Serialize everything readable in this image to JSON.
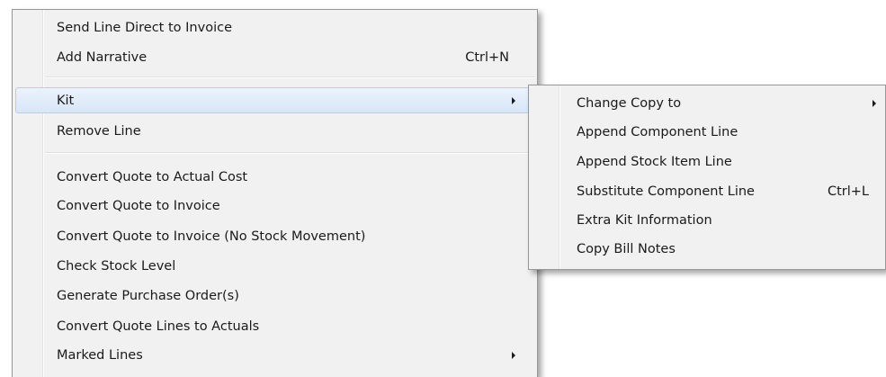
{
  "main_menu": {
    "items": [
      {
        "label": "Send Line Direct to Invoice"
      },
      {
        "label": "Add Narrative",
        "shortcut": "Ctrl+N"
      },
      {
        "label": "Kit"
      },
      {
        "label": "Remove Line"
      },
      {
        "label": "Convert Quote to Actual Cost"
      },
      {
        "label": "Convert Quote to Invoice"
      },
      {
        "label": "Convert Quote to Invoice (No Stock Movement)"
      },
      {
        "label": "Check Stock Level"
      },
      {
        "label": "Generate Purchase Order(s)"
      },
      {
        "label": "Convert Quote Lines to Actuals"
      },
      {
        "label": "Marked Lines"
      }
    ]
  },
  "kit_submenu": {
    "items": [
      {
        "label": "Change Copy to"
      },
      {
        "label": "Append Component Line"
      },
      {
        "label": "Append Stock Item Line"
      },
      {
        "label": "Substitute Component Line",
        "shortcut": "Ctrl+L"
      },
      {
        "label": "Extra Kit Information"
      },
      {
        "label": "Copy Bill Notes"
      }
    ]
  },
  "hover_item": "Kit",
  "colors": {
    "menu_bg": "#f1f1f1",
    "hover_bg": "#d8e6f8",
    "hover_border": "#aecff7"
  },
  "icons": [
    "submenu-arrow-icon"
  ]
}
